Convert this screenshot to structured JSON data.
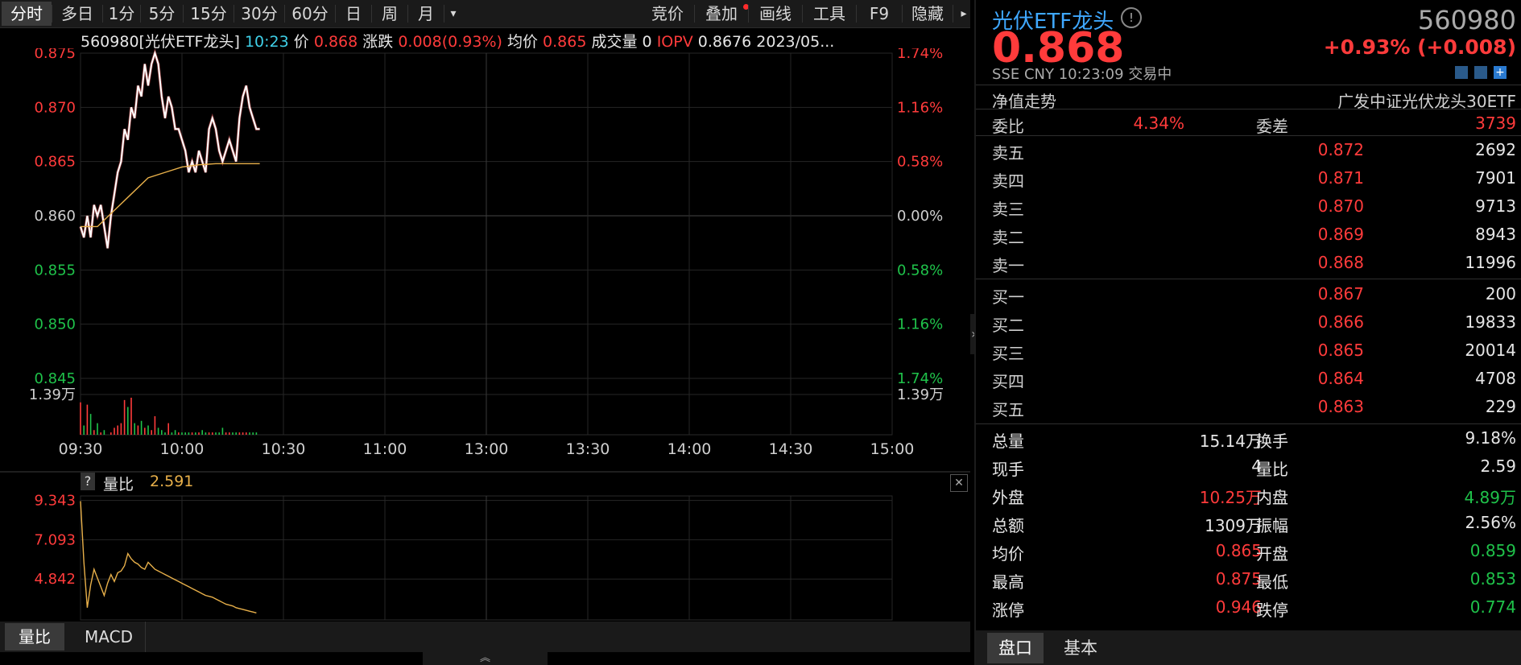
{
  "toolbar": {
    "periods": [
      "分时",
      "多日",
      "1分",
      "5分",
      "15分",
      "30分",
      "60分",
      "日",
      "周",
      "月"
    ],
    "active": "分时",
    "more_icon": "▾",
    "tools": [
      "竞价",
      "叠加",
      "画线",
      "工具",
      "F9",
      "隐藏"
    ],
    "arrow_icon": "▸"
  },
  "info": {
    "code_name": "560980[光伏ETF龙头]",
    "time": "10:23",
    "price_label": "价",
    "price": "0.868",
    "change_label": "涨跌",
    "change": "0.008(0.93%)",
    "avg_label": "均价",
    "avg": "0.865",
    "volume_label": "成交量",
    "volume": "0",
    "iopv_label": "IOPV",
    "iopv": "0.8676",
    "date": "2023/05..."
  },
  "main_chart": {
    "left_ticks": [
      "0.875",
      "0.870",
      "0.865",
      "0.860",
      "0.855",
      "0.850",
      "0.845"
    ],
    "right_ticks": [
      "1.74%",
      "1.16%",
      "0.58%",
      "0.00%",
      "0.58%",
      "1.16%",
      "1.74%"
    ],
    "vol_tick": "1.39万",
    "time_ticks": [
      "09:30",
      "10:00",
      "10:30",
      "11:00",
      "13:00",
      "13:30",
      "14:00",
      "14:30",
      "15:00"
    ]
  },
  "chart_data": {
    "type": "line",
    "title": "560980[光伏ETF龙头]",
    "x_range": [
      "09:30",
      "15:00"
    ],
    "ylim": [
      0.845,
      0.875
    ],
    "series": [
      {
        "name": "价",
        "color": "#ffffff",
        "x_minutes": [
          0,
          1,
          2,
          3,
          4,
          5,
          6,
          7,
          8,
          9,
          10,
          11,
          12,
          13,
          14,
          15,
          16,
          17,
          18,
          19,
          20,
          21,
          22,
          23,
          24,
          25,
          26,
          27,
          28,
          29,
          30,
          31,
          32,
          33,
          34,
          35,
          36,
          37,
          38,
          39,
          40,
          41,
          42,
          43,
          44,
          45,
          46,
          47,
          48,
          49,
          50,
          51,
          52,
          53
        ],
        "values": [
          0.859,
          0.858,
          0.86,
          0.858,
          0.861,
          0.86,
          0.861,
          0.859,
          0.857,
          0.86,
          0.862,
          0.864,
          0.865,
          0.868,
          0.867,
          0.87,
          0.869,
          0.872,
          0.871,
          0.874,
          0.872,
          0.874,
          0.875,
          0.874,
          0.871,
          0.869,
          0.871,
          0.87,
          0.868,
          0.868,
          0.867,
          0.866,
          0.864,
          0.865,
          0.864,
          0.866,
          0.865,
          0.864,
          0.868,
          0.869,
          0.868,
          0.866,
          0.865,
          0.866,
          0.867,
          0.866,
          0.865,
          0.869,
          0.871,
          0.872,
          0.87,
          0.869,
          0.868,
          0.868
        ]
      },
      {
        "name": "均价",
        "color": "#e8b04a",
        "x_minutes": [
          0,
          5,
          10,
          15,
          20,
          25,
          30,
          35,
          40,
          45,
          50,
          53
        ],
        "values": [
          0.859,
          0.859,
          0.8605,
          0.862,
          0.8635,
          0.864,
          0.8645,
          0.8647,
          0.8648,
          0.8648,
          0.8648,
          0.8648
        ]
      }
    ],
    "volume": [
      14,
      4,
      13,
      9,
      2,
      5,
      1,
      2,
      0,
      1,
      3,
      4,
      5,
      15,
      12,
      16,
      5,
      4,
      6,
      3,
      4,
      2,
      8,
      3,
      2,
      1,
      5,
      1,
      2,
      1,
      1,
      1,
      1,
      1,
      1,
      1,
      2,
      1,
      1,
      1,
      1,
      1,
      3,
      1,
      1,
      1,
      1,
      1,
      1,
      1,
      1,
      1,
      1
    ],
    "sub_chart": {
      "label": "量比",
      "value": "2.591",
      "ticks": [
        "9.343",
        "7.093",
        "4.842"
      ],
      "values": [
        9.3,
        5.8,
        3.2,
        4.5,
        5.4,
        4.9,
        4.4,
        3.9,
        4.6,
        5.1,
        4.7,
        5.2,
        5.3,
        5.6,
        6.3,
        6.0,
        5.8,
        5.7,
        5.5,
        5.4,
        5.8,
        5.6,
        5.4,
        5.3,
        5.2,
        5.1,
        5.0,
        4.9,
        4.8,
        4.7,
        4.6,
        4.5,
        4.4,
        4.3,
        4.2,
        4.1,
        4.0,
        3.9,
        3.85,
        3.8,
        3.7,
        3.6,
        3.5,
        3.4,
        3.35,
        3.3,
        3.2,
        3.15,
        3.1,
        3.05,
        3.0,
        2.95,
        2.9
      ]
    }
  },
  "sub_panel": {
    "help_icon": "?",
    "label": "量比",
    "value": "2.591",
    "close_icon": "✕",
    "tabs": [
      "量比",
      "MACD"
    ],
    "collapse_icon": "︽"
  },
  "sidebar": {
    "name": "光伏ETF龙头",
    "info_icon": "!",
    "code": "560980",
    "price": "0.868",
    "change": "+0.93% (+0.008)",
    "market": "SSE",
    "currency": "CNY",
    "time": "10:23:09",
    "status": "交易中",
    "nav_label": "净值走势",
    "index_name": "广发中证光伏龙头30ETF",
    "weibi_label": "委比",
    "weibi": "4.34%",
    "weicha_label": "委差",
    "weicha": "3739",
    "asks": [
      {
        "label": "卖五",
        "price": "0.872",
        "vol": "2692"
      },
      {
        "label": "卖四",
        "price": "0.871",
        "vol": "7901"
      },
      {
        "label": "卖三",
        "price": "0.870",
        "vol": "9713"
      },
      {
        "label": "卖二",
        "price": "0.869",
        "vol": "8943"
      },
      {
        "label": "卖一",
        "price": "0.868",
        "vol": "11996"
      }
    ],
    "bids": [
      {
        "label": "买一",
        "price": "0.867",
        "vol": "200"
      },
      {
        "label": "买二",
        "price": "0.866",
        "vol": "19833"
      },
      {
        "label": "买三",
        "price": "0.865",
        "vol": "20014"
      },
      {
        "label": "买四",
        "price": "0.864",
        "vol": "4708"
      },
      {
        "label": "买五",
        "price": "0.863",
        "vol": "229"
      }
    ],
    "stats": [
      {
        "l1": "总量",
        "v1": "15.14万",
        "c1": "white",
        "l2": "换手",
        "v2": "9.18%",
        "c2": "white"
      },
      {
        "l1": "现手",
        "v1": "4",
        "c1": "white",
        "l2": "量比",
        "v2": "2.59",
        "c2": "white"
      },
      {
        "l1": "外盘",
        "v1": "10.25万",
        "c1": "red",
        "l2": "内盘",
        "v2": "4.89万",
        "c2": "green"
      },
      {
        "l1": "总额",
        "v1": "1309万",
        "c1": "white",
        "l2": "振幅",
        "v2": "2.56%",
        "c2": "white"
      },
      {
        "l1": "均价",
        "v1": "0.865",
        "c1": "red",
        "l2": "开盘",
        "v2": "0.859",
        "c2": "green"
      },
      {
        "l1": "最高",
        "v1": "0.875",
        "c1": "red",
        "l2": "最低",
        "v2": "0.853",
        "c2": "green"
      },
      {
        "l1": "涨停",
        "v1": "0.946",
        "c1": "red",
        "l2": "跌停",
        "v2": "0.774",
        "c2": "green"
      }
    ],
    "tabs": [
      "盘口",
      "基本"
    ],
    "expand_icon": "»"
  },
  "colors": {
    "up": "#ff3b3b",
    "down": "#1fc24a",
    "price_line": "#ffffff",
    "avg_line": "#e8b04a",
    "grid": "#262626"
  }
}
